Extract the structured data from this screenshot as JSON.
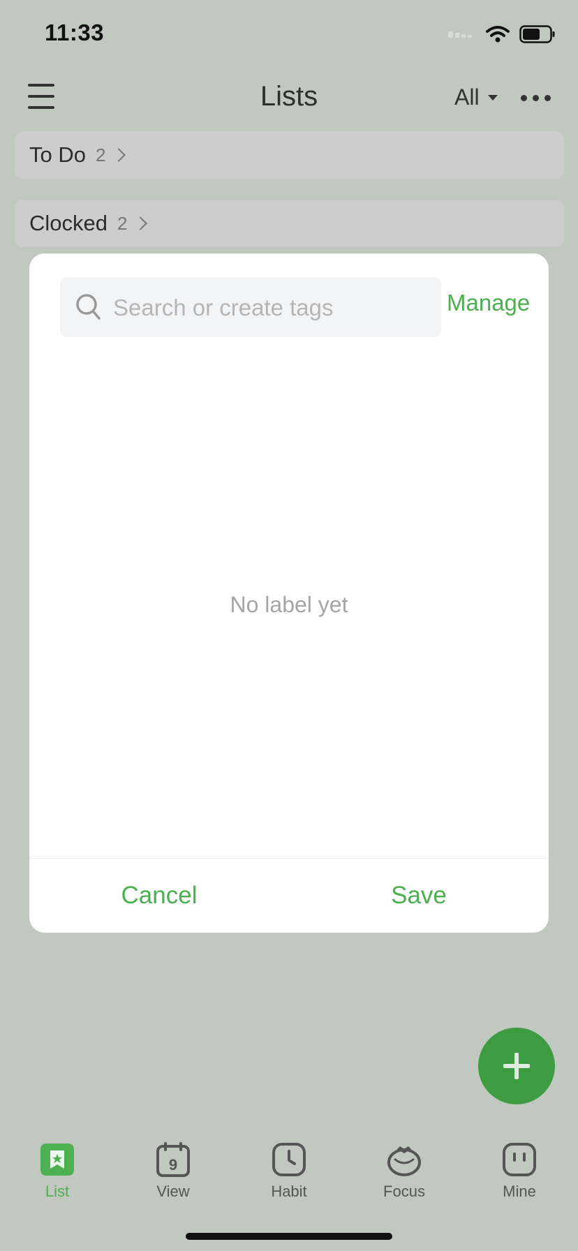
{
  "status_bar": {
    "time": "11:33"
  },
  "header": {
    "title": "Lists",
    "filter_label": "All"
  },
  "lists": [
    {
      "label": "To Do",
      "count": "2"
    },
    {
      "label": "Clocked",
      "count": "2"
    }
  ],
  "dialog": {
    "search_placeholder": "Search or create tags",
    "manage_label": "Manage",
    "empty_text": "No label yet",
    "cancel_label": "Cancel",
    "save_label": "Save"
  },
  "tab_bar": {
    "items": [
      {
        "label": "List",
        "icon": "list-icon",
        "active": true
      },
      {
        "label": "View",
        "icon": "calendar-icon",
        "calendar_day": "9"
      },
      {
        "label": "Habit",
        "icon": "clock-icon"
      },
      {
        "label": "Focus",
        "icon": "tomato-icon"
      },
      {
        "label": "Mine",
        "icon": "profile-icon"
      }
    ]
  },
  "colors": {
    "accent": "#4caf50",
    "fab": "#3d9c42",
    "overlay_bg": "#c0c8c0"
  }
}
